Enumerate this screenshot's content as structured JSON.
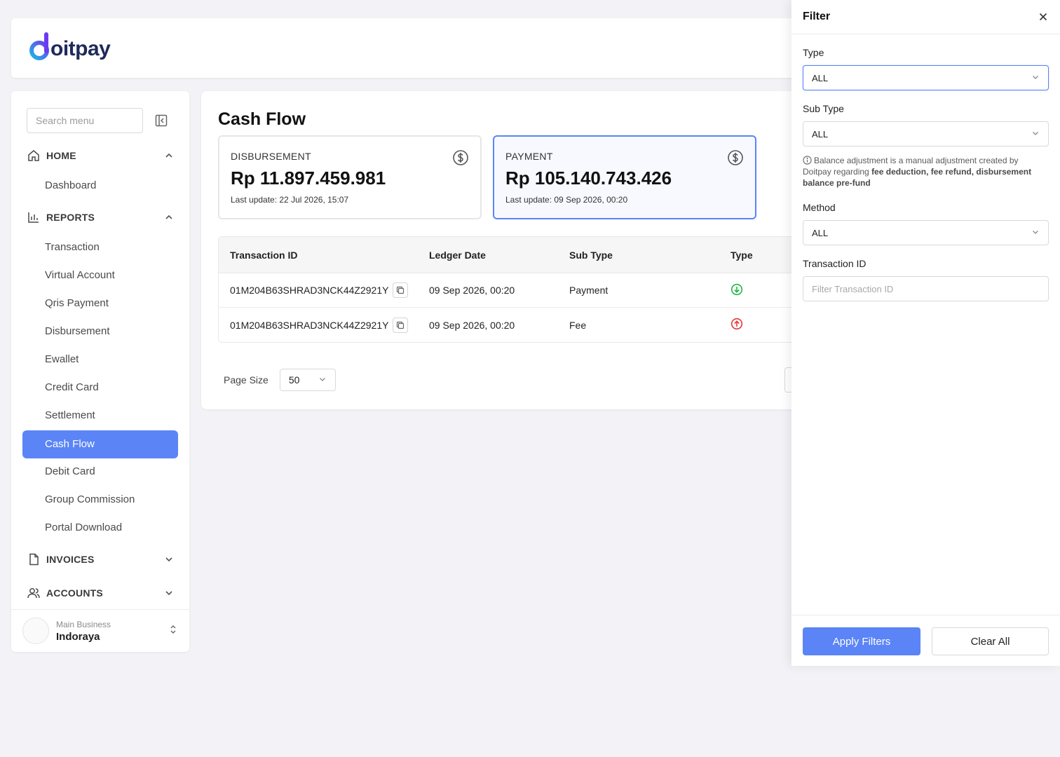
{
  "brand": {
    "logo_text": "oitpay",
    "primary_color": "#5b84f6"
  },
  "sidebar": {
    "search_placeholder": "Search menu",
    "groups": {
      "home": {
        "label": "HOME",
        "items": [
          "Dashboard"
        ]
      },
      "reports": {
        "label": "REPORTS",
        "items": [
          "Transaction",
          "Virtual Account",
          "Qris Payment",
          "Disbursement",
          "Ewallet",
          "Credit Card",
          "Settlement",
          "Cash Flow",
          "Debit Card",
          "Group Commission",
          "Portal Download"
        ],
        "active": "Cash Flow"
      },
      "invoices": {
        "label": "INVOICES"
      },
      "accounts": {
        "label": "ACCOUNTS"
      }
    },
    "account": {
      "subtitle": "Main Business",
      "name": "Indoraya"
    }
  },
  "main": {
    "title": "Cash Flow",
    "cards": [
      {
        "label": "DISBURSEMENT",
        "value": "Rp 11.897.459.981",
        "updated": "Last update: 22 Jul 2026, 15:07"
      },
      {
        "label": "PAYMENT",
        "value": "Rp 105.140.743.426",
        "updated": "Last update: 09 Sep 2026, 00:20"
      }
    ],
    "table": {
      "headers": [
        "Transaction ID",
        "Ledger Date",
        "Sub Type",
        "Type"
      ],
      "rows": [
        {
          "id": "01M204B63SHRAD3NCK44Z2921Y",
          "date": "09 Sep 2026, 00:20",
          "sub_type": "Payment",
          "type_icon": "arrow-down-circle-icon",
          "type_color": "#22b34a"
        },
        {
          "id": "01M204B63SHRAD3NCK44Z2921Y",
          "date": "09 Sep 2026, 00:20",
          "sub_type": "Fee",
          "type_icon": "arrow-up-circle-icon",
          "type_color": "#e5383b"
        }
      ]
    },
    "pager": {
      "label": "Page Size",
      "value": "50"
    }
  },
  "filter": {
    "title": "Filter",
    "type": {
      "label": "Type",
      "value": "ALL"
    },
    "sub_type": {
      "label": "Sub Type",
      "value": "ALL"
    },
    "note": {
      "text": "Balance adjustment is a manual adjustment created by Doitpay regarding ",
      "bold": "fee deduction, fee refund, disbursement balance pre-fund"
    },
    "method": {
      "label": "Method",
      "value": "ALL"
    },
    "transaction_id": {
      "label": "Transaction ID",
      "placeholder": "Filter Transaction ID"
    },
    "apply_label": "Apply Filters",
    "clear_label": "Clear All"
  }
}
